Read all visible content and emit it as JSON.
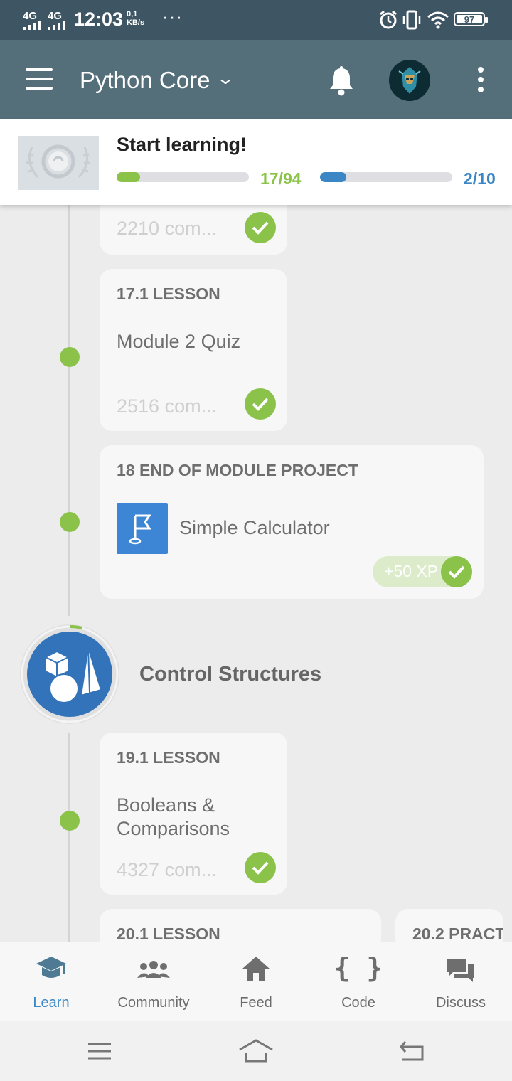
{
  "status_bar": {
    "signal_1": "4G",
    "signal_2": "4G",
    "time": "12:03",
    "speed_value": "0,1",
    "speed_unit": "KB/s",
    "more": "···",
    "battery": "97"
  },
  "app_bar": {
    "title": "Python Core"
  },
  "progress": {
    "heading": "Start learning!",
    "lessons_done": 17,
    "lessons_total": 94,
    "lessons_text": "17/94",
    "lessons_fraction": 0.18,
    "goal_text": "2/10",
    "goal_fraction": 0.2,
    "colors": {
      "green": "#8bc34a",
      "blue": "#3b86c4"
    }
  },
  "timeline": {
    "card_16": {
      "comments": "2210 com..."
    },
    "card_17": {
      "label": "17.1 LESSON",
      "title": "Module 2 Quiz",
      "comments": "2516 com..."
    },
    "card_18": {
      "label": "18 END OF MODULE PROJECT",
      "title": "Simple Calculator",
      "xp": "+50 XP",
      "icon": "flag-icon"
    },
    "module": {
      "title": "Control Structures",
      "icon": "shapes-icon"
    },
    "card_19": {
      "label": "19.1 LESSON",
      "title": "Booleans & Comparisons",
      "comments": "4327 com..."
    },
    "card_20a": {
      "label": "20.1 LESSON"
    },
    "card_20b": {
      "label": "20.2 PRACT"
    }
  },
  "bottom_nav": {
    "items": [
      {
        "label": "Learn",
        "icon": "graduation-cap-icon",
        "active": true
      },
      {
        "label": "Community",
        "icon": "people-icon",
        "active": false
      },
      {
        "label": "Feed",
        "icon": "home-icon",
        "active": false
      },
      {
        "label": "Code",
        "icon": "braces-icon",
        "active": false
      },
      {
        "label": "Discuss",
        "icon": "chat-icon",
        "active": false
      }
    ]
  }
}
